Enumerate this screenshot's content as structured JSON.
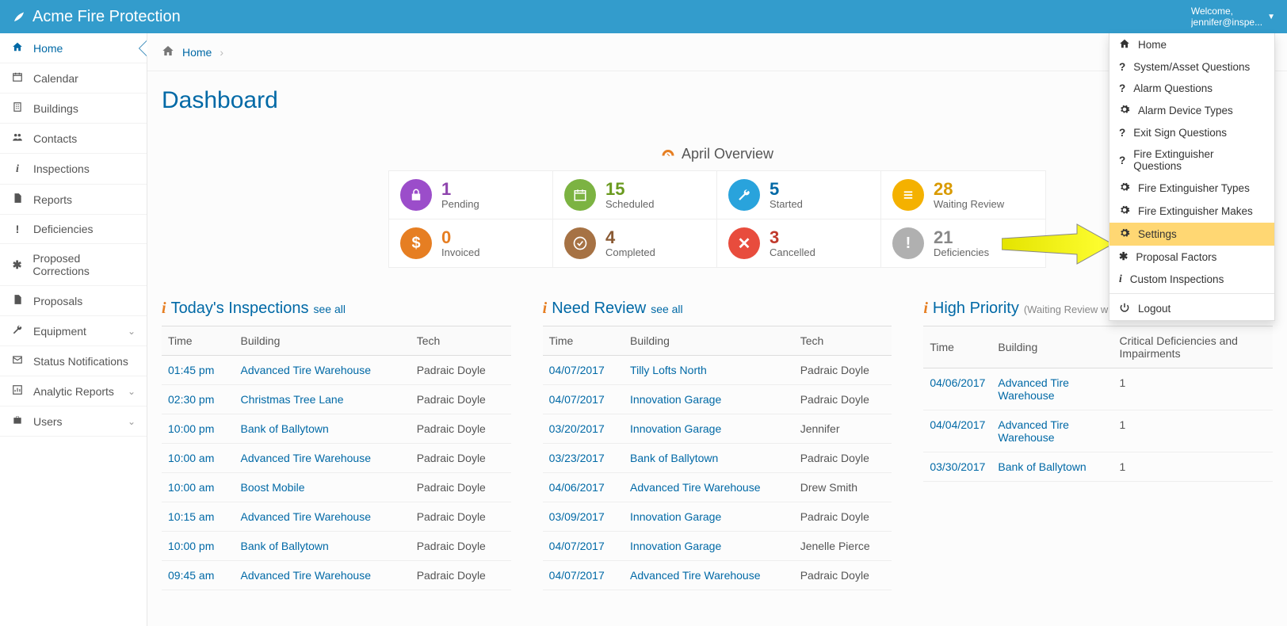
{
  "brand": "Acme Fire Protection",
  "welcome": {
    "prefix": "Welcome,",
    "user": "jennifer@inspe..."
  },
  "breadcrumb": {
    "home": "Home"
  },
  "page_title": "Dashboard",
  "sidebar": {
    "items": [
      {
        "label": "Home",
        "icon": "home",
        "active": true
      },
      {
        "label": "Calendar",
        "icon": "calendar"
      },
      {
        "label": "Buildings",
        "icon": "building"
      },
      {
        "label": "Contacts",
        "icon": "users"
      },
      {
        "label": "Inspections",
        "icon": "info"
      },
      {
        "label": "Reports",
        "icon": "file"
      },
      {
        "label": "Deficiencies",
        "icon": "warn"
      },
      {
        "label": "Proposed Corrections",
        "icon": "asterisk"
      },
      {
        "label": "Proposals",
        "icon": "file"
      },
      {
        "label": "Equipment",
        "icon": "wrench",
        "chevron": true
      },
      {
        "label": "Status Notifications",
        "icon": "mail"
      },
      {
        "label": "Analytic Reports",
        "icon": "chart",
        "chevron": true
      },
      {
        "label": "Users",
        "icon": "briefcase",
        "chevron": true
      }
    ]
  },
  "overview": {
    "title": "April Overview",
    "cells": [
      {
        "num": "1",
        "label": "Pending",
        "icon_bg": "color-purple",
        "num_cls": "num-purple",
        "glyph": "lock"
      },
      {
        "num": "15",
        "label": "Scheduled",
        "icon_bg": "color-green",
        "num_cls": "num-green",
        "glyph": "cal"
      },
      {
        "num": "5",
        "label": "Started",
        "icon_bg": "color-blue",
        "num_cls": "num-blue",
        "glyph": "wrench"
      },
      {
        "num": "28",
        "label": "Waiting Review",
        "icon_bg": "color-yellow",
        "num_cls": "num-yellow",
        "glyph": "list"
      },
      {
        "num": "0",
        "label": "Invoiced",
        "icon_bg": "color-orange",
        "num_cls": "num-orange",
        "glyph": "dollar"
      },
      {
        "num": "4",
        "label": "Completed",
        "icon_bg": "color-brown",
        "num_cls": "num-brown",
        "glyph": "check"
      },
      {
        "num": "3",
        "label": "Cancelled",
        "icon_bg": "color-red",
        "num_cls": "num-red",
        "glyph": "x"
      },
      {
        "num": "21",
        "label": "Deficiencies",
        "icon_bg": "color-grey",
        "num_cls": "num-grey",
        "glyph": "excl"
      }
    ]
  },
  "dropdown": {
    "items": [
      {
        "label": "Home",
        "icon": "home"
      },
      {
        "label": "System/Asset Questions",
        "icon": "question"
      },
      {
        "label": "Alarm Questions",
        "icon": "question"
      },
      {
        "label": "Alarm Device Types",
        "icon": "gear"
      },
      {
        "label": "Exit Sign Questions",
        "icon": "question"
      },
      {
        "label": "Fire Extinguisher Questions",
        "icon": "question"
      },
      {
        "label": "Fire Extinguisher Types",
        "icon": "gear"
      },
      {
        "label": "Fire Extinguisher Makes",
        "icon": "gear"
      },
      {
        "label": "Settings",
        "icon": "gear",
        "highlight": true
      },
      {
        "label": "Proposal Factors",
        "icon": "asterisk"
      },
      {
        "label": "Custom Inspections",
        "icon": "info"
      }
    ],
    "logout": "Logout"
  },
  "tables": {
    "today": {
      "title": "Today's Inspections",
      "see_all": "see all",
      "headers": [
        "Time",
        "Building",
        "Tech"
      ],
      "rows": [
        [
          "01:45 pm",
          "Advanced Tire Warehouse",
          "Padraic Doyle"
        ],
        [
          "02:30 pm",
          "Christmas Tree Lane",
          "Padraic Doyle"
        ],
        [
          "10:00 pm",
          "Bank of Ballytown",
          "Padraic Doyle"
        ],
        [
          "10:00 am",
          "Advanced Tire Warehouse",
          "Padraic Doyle"
        ],
        [
          "10:00 am",
          "Boost Mobile",
          "Padraic Doyle"
        ],
        [
          "10:15 am",
          "Advanced Tire Warehouse",
          "Padraic Doyle"
        ],
        [
          "10:00 pm",
          "Bank of Ballytown",
          "Padraic Doyle"
        ],
        [
          "09:45 am",
          "Advanced Tire Warehouse",
          "Padraic Doyle"
        ]
      ]
    },
    "review": {
      "title": "Need Review",
      "see_all": "see all",
      "headers": [
        "Time",
        "Building",
        "Tech"
      ],
      "rows": [
        [
          "04/07/2017",
          "Tilly Lofts North",
          "Padraic Doyle"
        ],
        [
          "04/07/2017",
          "Innovation Garage",
          "Padraic Doyle"
        ],
        [
          "03/20/2017",
          "Innovation Garage",
          "Jennifer"
        ],
        [
          "03/23/2017",
          "Bank of Ballytown",
          "Padraic Doyle"
        ],
        [
          "04/06/2017",
          "Advanced Tire Warehouse",
          "Drew Smith"
        ],
        [
          "03/09/2017",
          "Innovation Garage",
          "Padraic Doyle"
        ],
        [
          "04/07/2017",
          "Innovation Garage",
          "Jenelle Pierce"
        ],
        [
          "04/07/2017",
          "Advanced Tire Warehouse",
          "Padraic Doyle"
        ]
      ]
    },
    "priority": {
      "title": "High Priority",
      "note": "(Waiting Review with Critical Deficiences)",
      "headers": [
        "Time",
        "Building",
        "Critical Deficiencies and Impairments"
      ],
      "rows": [
        [
          "04/06/2017",
          "Advanced Tire Warehouse",
          "1"
        ],
        [
          "04/04/2017",
          "Advanced Tire Warehouse",
          "1"
        ],
        [
          "03/30/2017",
          "Bank of Ballytown",
          "1"
        ]
      ]
    }
  }
}
